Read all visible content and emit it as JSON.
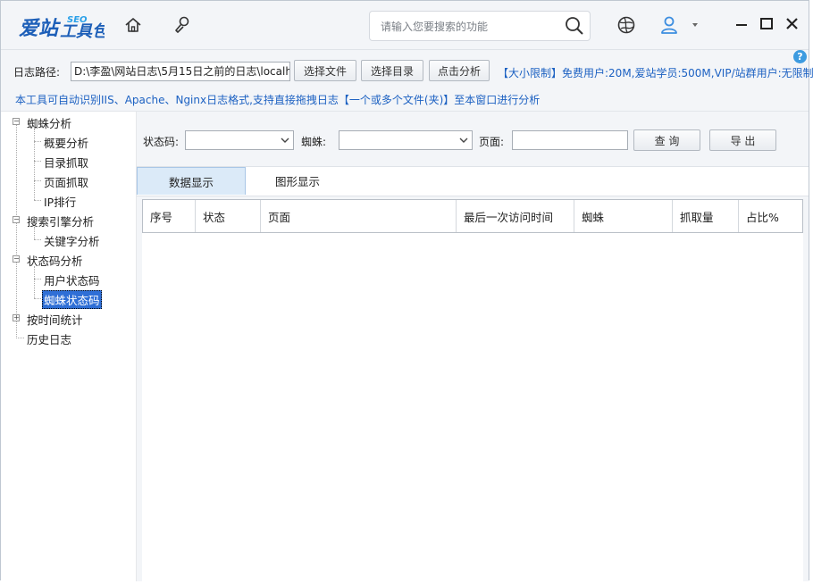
{
  "app": {
    "logo_text": "爱站工具包",
    "logo_sup": "SEO"
  },
  "search": {
    "placeholder": "请输入您要搜索的功能"
  },
  "toolbar": {
    "path_label": "日志路径:",
    "path_value": "D:\\李盈\\网站日志\\5月15日之前的日志\\localh",
    "select_file": "选择文件",
    "select_dir": "选择目录",
    "analyze": "点击分析",
    "limit_text": "【大小限制】免费用户:20M,爱站学员:500M,VIP/站群用户:无限制",
    "notice": "本工具可自动识别IIS、Apache、Nginx日志格式,支持直接拖拽日志【一个或多个文件(夹)】至本窗口进行分析",
    "help": "?"
  },
  "tree": {
    "spider_analysis": "蜘蛛分析",
    "overview": "概要分析",
    "dir_crawl": "目录抓取",
    "page_crawl": "页面抓取",
    "ip_rank": "IP排行",
    "search_engine": "搜索引擎分析",
    "keyword": "关键字分析",
    "status_code": "状态码分析",
    "user_status": "用户状态码",
    "spider_status": "蜘蛛状态码",
    "by_time": "按时间统计",
    "history": "历史日志"
  },
  "filters": {
    "status_label": "状态码:",
    "status_value": "",
    "spider_label": "蜘蛛:",
    "spider_value": "",
    "page_label": "页面:",
    "page_value": "",
    "query": "查 询",
    "export": "导 出"
  },
  "tabs": {
    "data": "数据显示",
    "chart": "图形显示"
  },
  "table": {
    "columns": [
      "序号",
      "状态",
      "页面",
      "最后一次访问时间",
      "蜘蛛",
      "抓取量",
      "占比%"
    ]
  },
  "colors": {
    "accent": "#1c61c2",
    "selected": "#2f6fd6"
  }
}
